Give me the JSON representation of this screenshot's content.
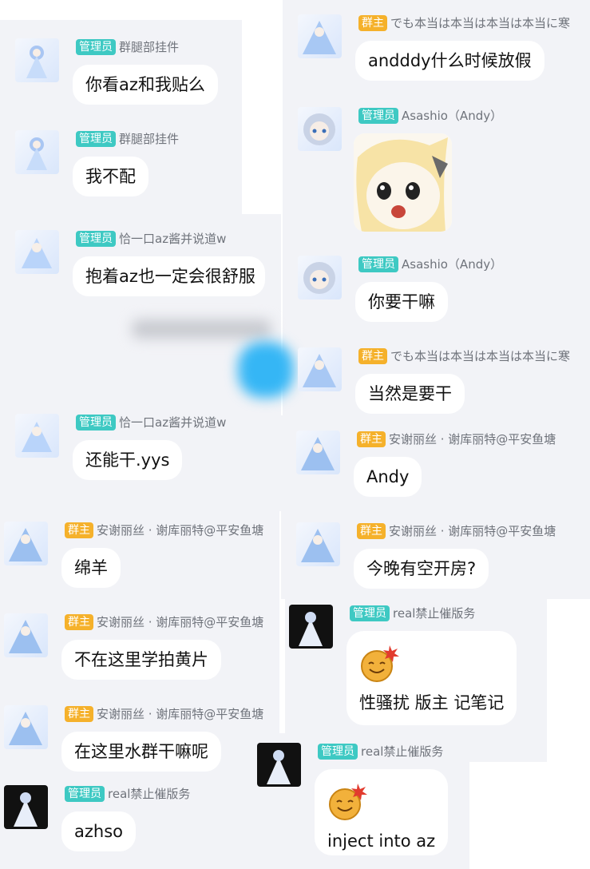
{
  "roles": {
    "admin": "管理员",
    "owner": "群主"
  },
  "colors": {
    "admin_badge": "#3ec9c3",
    "owner_badge": "#f5b12b",
    "panel_bg": "#f2f3f7",
    "bubble_bg": "#ffffff"
  },
  "left_column": {
    "messages": [
      {
        "role": "管理员",
        "user": "群腿部挂件",
        "text": "你看az和我贴么"
      },
      {
        "role": "管理员",
        "user": "群腿部挂件",
        "text": "我不配"
      },
      {
        "role": "管理员",
        "user": "恰一口az酱并说道w",
        "text": "抱着az也一定会很舒服"
      },
      {
        "role": "管理员",
        "user": "恰一口az酱并说道w",
        "text": "还能干.yys"
      },
      {
        "role": "群主",
        "user": "安谢丽丝 · 谢库丽特@平安鱼塘",
        "text": "绵羊"
      },
      {
        "role": "群主",
        "user": "安谢丽丝 · 谢库丽特@平安鱼塘",
        "text": "不在这里学拍黄片"
      },
      {
        "role": "群主",
        "user": "安谢丽丝 · 谢库丽特@平安鱼塘",
        "text": "在这里水群干嘛呢"
      },
      {
        "role": "管理员",
        "user": "real禁止催版务",
        "text": "azhso"
      }
    ]
  },
  "right_column": {
    "messages": [
      {
        "role": "群主",
        "user": "でも本当は本当は本当は本当に寒",
        "text": "andddy什么时候放假"
      },
      {
        "role": "管理员",
        "user": "Asashio（Andy）",
        "sticker": "sticker-face"
      },
      {
        "role": "管理员",
        "user": "Asashio（Andy）",
        "text": "你要干嘛"
      },
      {
        "role": "群主",
        "user": "でも本当は本当は本当は本当に寒",
        "text": "当然是要干"
      },
      {
        "role": "群主",
        "user": "安谢丽丝 · 谢库丽特@平安鱼塘",
        "text": "Andy"
      },
      {
        "role": "群主",
        "user": "安谢丽丝 · 谢库丽特@平安鱼塘",
        "text": "今晚有空开房?"
      },
      {
        "role": "管理员",
        "user": "real禁止催版务",
        "text": "性骚扰 版主 记笔记"
      },
      {
        "role": "管理员",
        "user": "real禁止催版务",
        "text": "inject into az"
      }
    ]
  }
}
